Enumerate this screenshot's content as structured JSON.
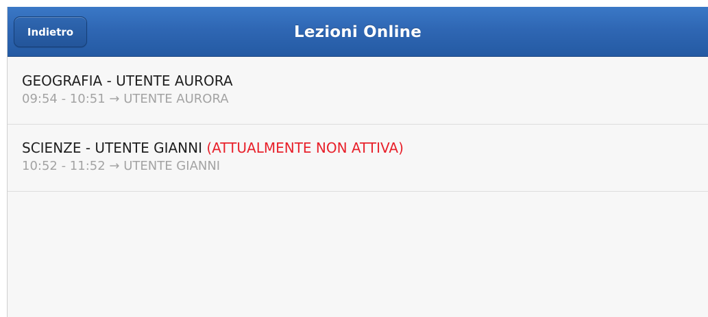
{
  "navbar": {
    "back_label": "Indietro",
    "title": "Lezioni Online"
  },
  "lessons": [
    {
      "title": "GEOGRAFIA - UTENTE AURORA",
      "status": "",
      "subtitle": "09:54 - 10:51 → UTENTE AURORA"
    },
    {
      "title": "SCIENZE - UTENTE GIANNI",
      "status": "(ATTUALMENTE NON ATTIVA)",
      "subtitle": "10:52 - 11:52 → UTENTE GIANNI"
    }
  ],
  "colors": {
    "navbar_blue": "#2f67b4",
    "status_red": "#e8202a",
    "subtitle_gray": "#a3a3a3",
    "background": "#f7f7f7"
  }
}
